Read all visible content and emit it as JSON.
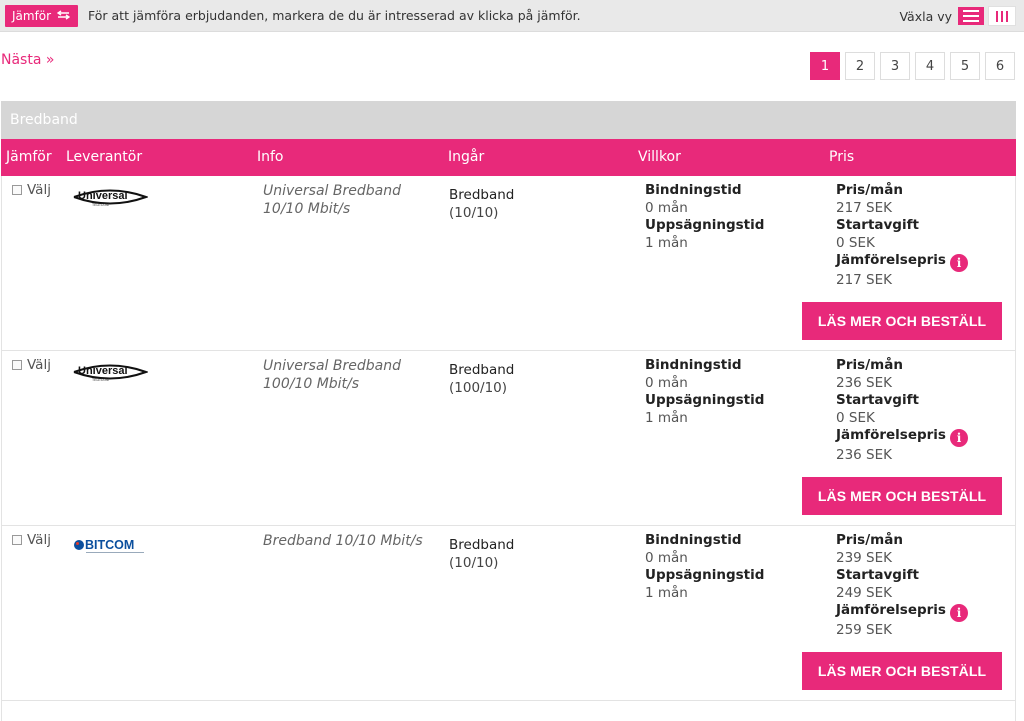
{
  "topbar": {
    "compare_label": "Jämför",
    "message": "För att jämföra erbjudanden, markera de du är intresserad av klicka på jämför.",
    "view_label": "Växla vy"
  },
  "nav": {
    "next_label": "Nästa »",
    "pages": [
      "1",
      "2",
      "3",
      "4",
      "5",
      "6"
    ],
    "active_page": "1"
  },
  "table": {
    "category": "Bredband",
    "headers": {
      "compare": "Jämför",
      "provider": "Leverantör",
      "info": "Info",
      "includes": "Ingår",
      "terms": "Villkor",
      "price": "Pris"
    },
    "rows": [
      {
        "select_label": "Välj",
        "provider_logo": "universal-telecom-logo",
        "logo_text": "Universal",
        "logo_sub": "TELECOM",
        "info": "Universal Bredband 10/10 Mbit/s",
        "includes_title": "Bredband",
        "includes_detail": "(10/10)",
        "binding_label": "Bindningstid",
        "binding_value": "0 mån",
        "notice_label": "Uppsägningstid",
        "notice_value": "1 mån",
        "monthly_label": "Pris/mån",
        "monthly_value": "217 SEK",
        "start_label": "Startavgift",
        "start_value": "0 SEK",
        "compare_label": "Jämförelsepris",
        "compare_value": "217 SEK",
        "order_label": "LÄS MER OCH BESTÄLL"
      },
      {
        "select_label": "Välj",
        "provider_logo": "universal-telecom-logo",
        "logo_text": "Universal",
        "logo_sub": "TELECOM",
        "info": "Universal Bredband 100/10 Mbit/s",
        "includes_title": "Bredband",
        "includes_detail": "(100/10)",
        "binding_label": "Bindningstid",
        "binding_value": "0 mån",
        "notice_label": "Uppsägningstid",
        "notice_value": "1 mån",
        "monthly_label": "Pris/mån",
        "monthly_value": "236 SEK",
        "start_label": "Startavgift",
        "start_value": "0 SEK",
        "compare_label": "Jämförelsepris",
        "compare_value": "236 SEK",
        "order_label": "LÄS MER OCH BESTÄLL"
      },
      {
        "select_label": "Välj",
        "provider_logo": "bitcom-logo",
        "logo_text": "BITCOM",
        "info": "Bredband 10/10 Mbit/s",
        "includes_title": "Bredband",
        "includes_detail": "(10/10)",
        "binding_label": "Bindningstid",
        "binding_value": "0 mån",
        "notice_label": "Uppsägningstid",
        "notice_value": "1 mån",
        "monthly_label": "Pris/mån",
        "monthly_value": "239 SEK",
        "start_label": "Startavgift",
        "start_value": "249 SEK",
        "compare_label": "Jämförelsepris",
        "compare_value": "259 SEK",
        "order_label": "LÄS MER OCH BESTÄLL"
      }
    ]
  },
  "colors": {
    "accent": "#e8297a",
    "category_bg": "#d6d6d6",
    "topbar_bg": "#e9e9e9"
  },
  "icons": {
    "compare": "compare-arrows-icon",
    "list_view": "list-view-icon",
    "column_view": "column-view-icon",
    "info": "info-icon"
  }
}
